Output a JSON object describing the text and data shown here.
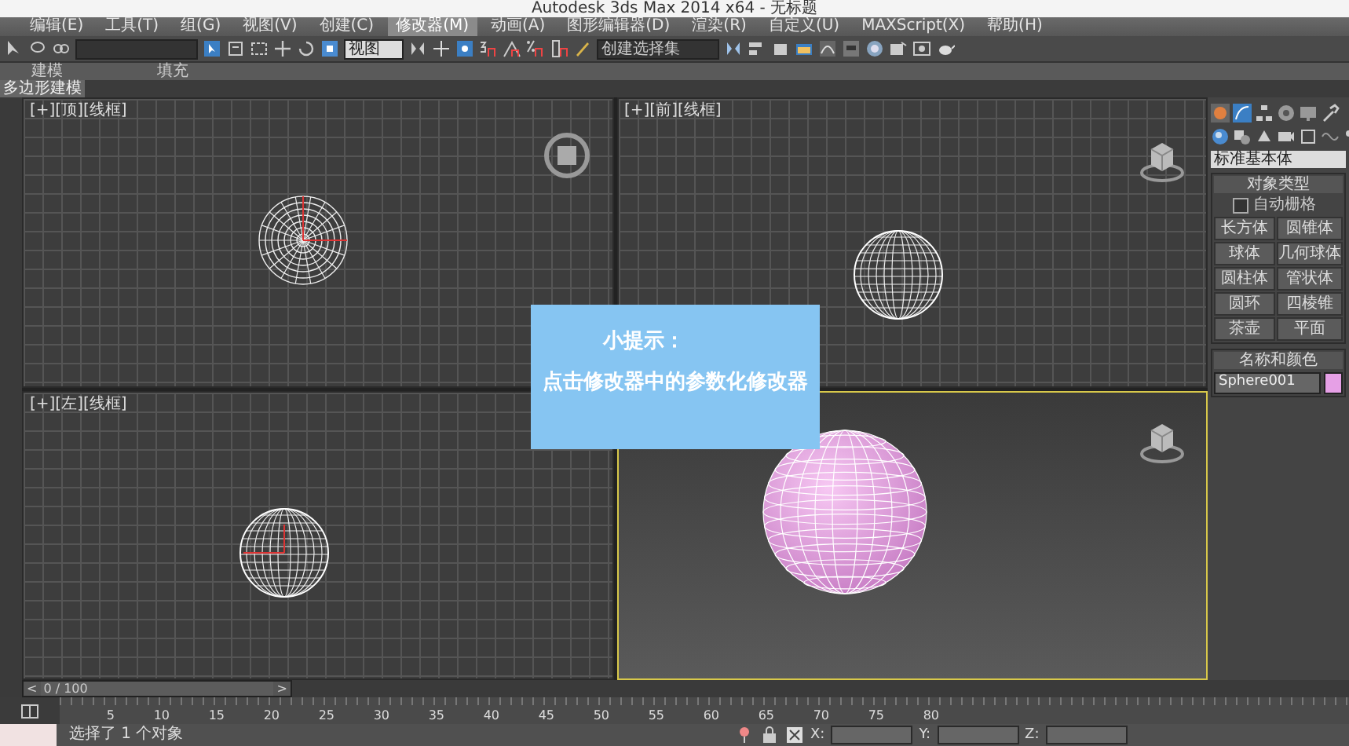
{
  "window": {
    "title": "Autodesk 3ds Max 2014 x64 - 无标题"
  },
  "menu": [
    {
      "label": "编辑(E)",
      "selected": false
    },
    {
      "label": "工具(T)",
      "selected": false
    },
    {
      "label": "组(G)",
      "selected": false
    },
    {
      "label": "视图(V)",
      "selected": false
    },
    {
      "label": "创建(C)",
      "selected": false
    },
    {
      "label": "修改器(M)",
      "selected": true
    },
    {
      "label": "动画(A)",
      "selected": false
    },
    {
      "label": "图形编辑器(D)",
      "selected": false
    },
    {
      "label": "渲染(R)",
      "selected": false
    },
    {
      "label": "自定义(U)",
      "selected": false
    },
    {
      "label": "MAXScript(X)",
      "selected": false
    },
    {
      "label": "帮助(H)",
      "selected": false
    }
  ],
  "toolbar": {
    "reference_dropdown": "视图",
    "selection_set_dropdown": "创建选择集"
  },
  "ribbon": {
    "tabs": [
      "建模",
      "填充"
    ],
    "subtitle": "多边形建模"
  },
  "viewports": [
    {
      "kind": "top",
      "label": "[+][顶][线框]",
      "active": false
    },
    {
      "kind": "front",
      "label": "[+][前][线框]",
      "active": false
    },
    {
      "kind": "left",
      "label": "[+][左][线框]",
      "active": false
    },
    {
      "kind": "perspective",
      "active": true
    }
  ],
  "tip": {
    "title": "小提示：",
    "text": "点击修改器中的参数化修改器"
  },
  "command_panel": {
    "category": "标准基本体",
    "object_type": {
      "title": "对象类型",
      "autogrid": {
        "label": "自动栅格",
        "checked": false
      },
      "buttons": [
        "长方体",
        "圆锥体",
        "球体",
        "几何球体",
        "圆柱体",
        "管状体",
        "圆环",
        "四棱锥",
        "茶壶",
        "平面"
      ]
    },
    "name_color": {
      "title": "名称和颜色",
      "name": "Sphere001",
      "color": "#e6a0e6"
    }
  },
  "timeline": {
    "level": 0,
    "prev": "<",
    "frame": "0 / 100",
    "next": ">",
    "ticks": [
      "5",
      "10",
      "15",
      "20",
      "25",
      "30",
      "35",
      "40",
      "45",
      "50",
      "55",
      "60",
      "65",
      "70",
      "75",
      "80"
    ]
  },
  "status": {
    "text": "选择了 1 个对象",
    "coords": [
      "X:",
      "Y:",
      "Z:"
    ]
  }
}
